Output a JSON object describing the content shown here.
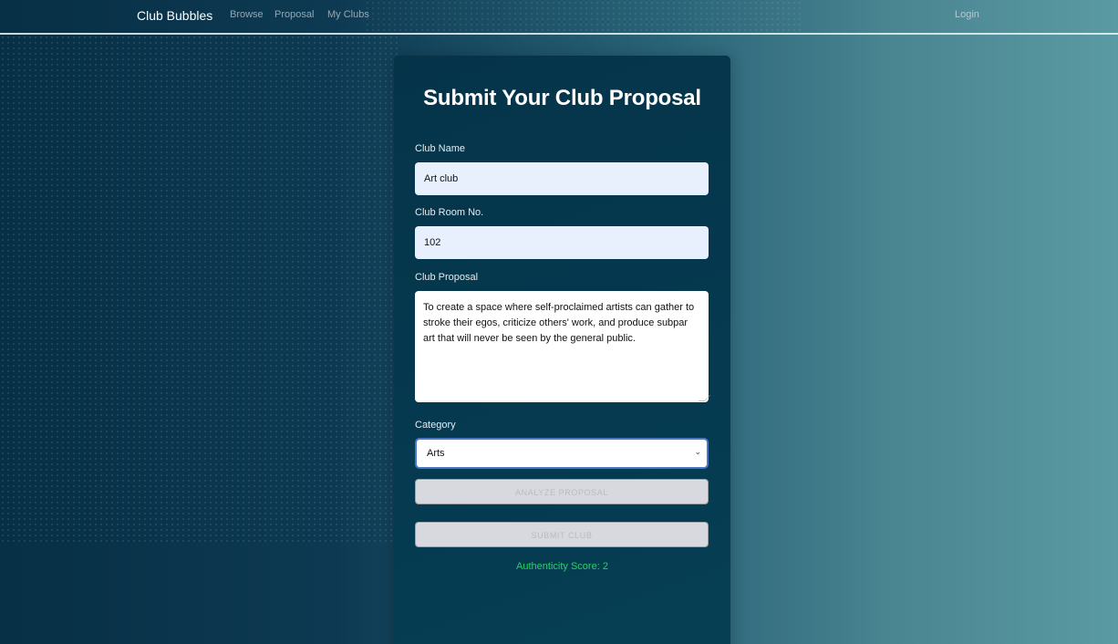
{
  "nav": {
    "brand": "Club Bubbles",
    "links": [
      "Browse",
      "Proposal",
      "My Clubs"
    ],
    "login": "Login"
  },
  "form": {
    "title": "Submit Your Club Proposal",
    "club_name_label": "Club Name",
    "club_name_value": "Art club",
    "room_label": "Club Room No.",
    "room_value": "102",
    "proposal_label": "Club Proposal",
    "proposal_value": "To create a space where self-proclaimed artists can gather to stroke their egos, criticize others' work, and produce subpar art that will never be seen by the general public.",
    "category_label": "Category",
    "category_value": "Arts",
    "analyze_button": "ANALYZE PROPOSAL",
    "submit_button": "SUBMIT CLUB",
    "score_label": "Authenticity Score:",
    "score_value": "2"
  },
  "colors": {
    "score": "#23d460",
    "select_focus": "#4a78c8",
    "input_autofill": "#e8f0fe"
  },
  "icons": {
    "select_chevron": "chevron-down-icon"
  }
}
